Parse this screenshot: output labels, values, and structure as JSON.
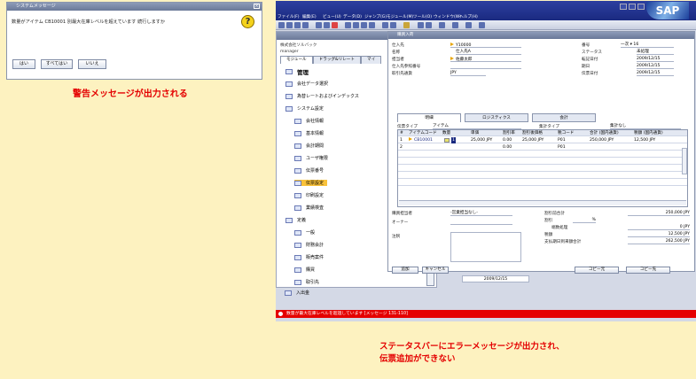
{
  "dialog": {
    "title": "システムメッセージ",
    "message": "数量がアイテム CB10001 別最大在庫レベルを超えています 続行しますか",
    "buttons": [
      "はい",
      "すべてはい",
      "いいえ"
    ]
  },
  "caption_top": "警告メッセージが出力される",
  "caption_bottom": [
    "ステータスバーにエラーメッセージが出力され、",
    "伝票追加ができない"
  ],
  "sap": {
    "menu": [
      "ファイル(F)",
      "編集(E)",
      "ビュー(U)",
      "データ(D)",
      "ジャンプ(G)",
      "モジュール(M)",
      "ツール(O)",
      "ウィンドウ(W)",
      "ヘルプ(H)"
    ],
    "logo": "SAP",
    "nav": {
      "company": "株式会社ソルバック",
      "user": "manager",
      "tabs": [
        "モジュール",
        "ドラッグ&リレート",
        "マイ"
      ],
      "heading": "管理",
      "items": [
        "会社データ選択",
        "為替レートおよびインデックス",
        "システム設定",
        "会社情報",
        "基本情報",
        "会計期間",
        "ユーザ権限",
        "伝票番号",
        "伝票設定",
        "印刷設定",
        "業績検査",
        "定義",
        "一般",
        "財務会計",
        "販売案件",
        "購買",
        "取引先",
        "入出金",
        "在庫",
        "サービス",
        "インポート/エクスポート"
      ]
    },
    "document": {
      "title": "購買入荷",
      "left_labels": [
        "仕入先",
        "名称",
        "担当者",
        "仕入先参照番号",
        "取引先通貨"
      ],
      "left_values": [
        "Y10000",
        "仕入先A",
        "佐藤太郎",
        "",
        "JPY"
      ],
      "right_labels": [
        "番号",
        "ステータス",
        "転記日付",
        "期日",
        "伝票日付"
      ],
      "right_values": [
        "一次   ▾   16",
        "未処理",
        "2009/12/15",
        "2009/12/15",
        "2009/12/15"
      ],
      "tabs": [
        "明細",
        "ロジスティクス",
        "会計"
      ],
      "doc_type_label": "伝票タイプ",
      "doc_type_value": "アイテム",
      "summary_type_label": "集計タイプ",
      "summary_type_value": "集計なし",
      "columns": [
        "#",
        "アイテムコード",
        "数量",
        "単価",
        "割引率",
        "割引後価格",
        "税コード",
        "合計 (国内通貨)",
        "税額 (国内通貨)"
      ],
      "rows": [
        [
          "1",
          "CB10001",
          "1",
          "25,000 JPY",
          "0.00",
          "25,000 JPY",
          "P01",
          "250,000 JPY",
          "12,500 JPY"
        ],
        [
          "2",
          "",
          "",
          "",
          "0.00",
          "",
          "P01",
          "",
          ""
        ]
      ],
      "footer_labels": [
        "購買担当者",
        "オーナー",
        "注釈"
      ],
      "buyer_value": "-営業担当なし-",
      "totals_labels": [
        "割引前合計",
        "割引",
        "端数処理",
        "税額",
        "支払期日到来額合計"
      ],
      "totals_values": [
        "250,000 JPY",
        "%",
        "0 JPY",
        "12,500 JPY",
        "262,500 JPY"
      ],
      "buttons": [
        "追加",
        "キャンセル",
        "コピー元",
        "コピー先"
      ]
    },
    "date": "2009/12/15",
    "status_message": "数量が最大在庫レベルを超過しています [メッセージ 131-110]"
  }
}
